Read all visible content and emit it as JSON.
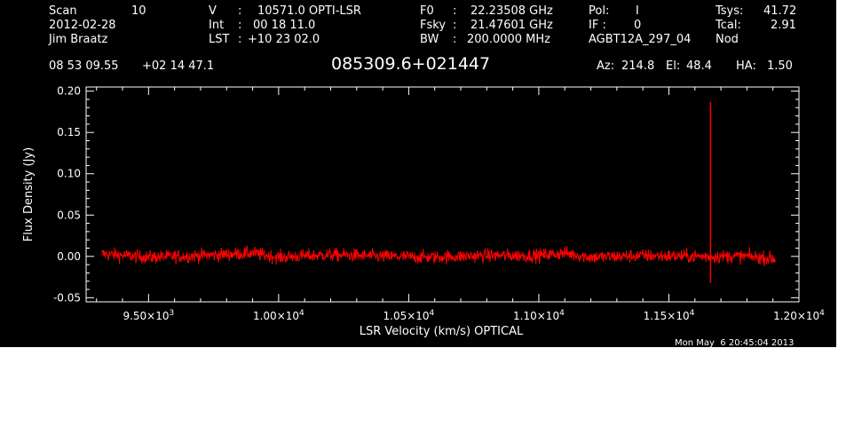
{
  "header": {
    "scan_label": "Scan",
    "scan_value": "10",
    "date": "2012-02-28",
    "observer": "Jim Braatz",
    "v_label": "V",
    "v_sep": ":",
    "v_value": "10571.0 OPTI-LSR",
    "int_label": "Int",
    "int_sep": ":",
    "int_value": "00 18 11.0",
    "lst_label": "LST",
    "lst_sep": ":",
    "lst_value": "+10 23 02.0",
    "f0_label": "F0",
    "f0_sep": ":",
    "f0_value": "22.23508 GHz",
    "fsky_label": "Fsky",
    "fsky_sep": ":",
    "fsky_value": "21.47601 GHz",
    "bw_label": "BW",
    "bw_sep": ":",
    "bw_value": "200.0000 MHz",
    "pol_label": "Pol:",
    "pol_value": "I",
    "if_label": "IF :",
    "if_value": "0",
    "project": "AGBT12A_297_04",
    "tsys_label": "Tsys:",
    "tsys_value": "41.72",
    "tcal_label": "Tcal:",
    "tcal_value": "2.91",
    "mode": "Nod",
    "ra": "08 53 09.55",
    "dec": "+02 14 47.1",
    "source": "085309.6+021447",
    "az_label": "Az:",
    "az_value": "214.8",
    "el_label": "El:",
    "el_value": "48.4",
    "ha_label": "HA:",
    "ha_value": "1.50"
  },
  "timestamp": "Mon May  6 20:45:04 2013",
  "colors": {
    "background": "#000000",
    "foreground": "#ffffff",
    "series": "#ff0000"
  },
  "chart_data": {
    "type": "line",
    "title": "085309.6+021447",
    "xlabel": "LSR Velocity (km/s) OPTICAL",
    "ylabel": "Flux Density (Jy)",
    "xlim": [
      9260,
      12000
    ],
    "ylim": [
      -0.055,
      0.205
    ],
    "xticks": [
      {
        "value": 9500,
        "mantissa": "9.50",
        "exp": "3"
      },
      {
        "value": 10000,
        "mantissa": "1.00",
        "exp": "4"
      },
      {
        "value": 10500,
        "mantissa": "1.05",
        "exp": "4"
      },
      {
        "value": 11000,
        "mantissa": "1.10",
        "exp": "4"
      },
      {
        "value": 11500,
        "mantissa": "1.15",
        "exp": "4"
      },
      {
        "value": 12000,
        "mantissa": "1.20",
        "exp": "4"
      }
    ],
    "yticks": [
      {
        "value": -0.05,
        "label": "-0.05"
      },
      {
        "value": 0.0,
        "label": "0.00"
      },
      {
        "value": 0.05,
        "label": "0.05"
      },
      {
        "value": 0.1,
        "label": "0.10"
      },
      {
        "value": 0.15,
        "label": "0.15"
      },
      {
        "value": 0.2,
        "label": "0.20"
      }
    ],
    "series": [
      {
        "x_start": 9320,
        "x_end": 11910,
        "noise_rms": 0.004,
        "values": [
          [
            9320,
            0.003
          ],
          [
            9500,
            -0.001
          ],
          [
            9700,
            0.001
          ],
          [
            9900,
            0.004
          ],
          [
            10000,
            -0.001
          ],
          [
            10200,
            0.002
          ],
          [
            10400,
            0.0
          ],
          [
            10600,
            -0.001
          ],
          [
            10800,
            0.001
          ],
          [
            11000,
            0.001
          ],
          [
            11100,
            0.004
          ],
          [
            11200,
            -0.001
          ],
          [
            11400,
            0.001
          ],
          [
            11600,
            0.0
          ],
          [
            11800,
            0.0
          ],
          [
            11910,
            -0.003
          ]
        ],
        "spikes": [
          {
            "x": 11660,
            "peak": 0.187,
            "trough": -0.032
          }
        ]
      }
    ],
    "grid": false,
    "legend": "none"
  }
}
